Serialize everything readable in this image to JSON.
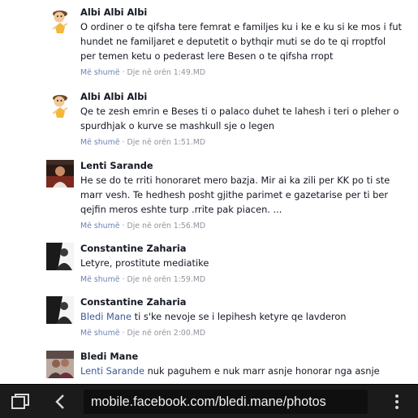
{
  "comments": [
    {
      "author": "Albi Albi Albi",
      "avatar_icon": "cartoon-character-avatar-icon",
      "lines": [
        "O ordiner o te qifsha tere femrat e familjes ku i ke e ku si ke mos i fut",
        "hundet ne familjaret e deputetit o bythqir muti se do te qi rroptfol",
        "per temen ketu o pederast lere Besen o te qifsha rropt"
      ],
      "like_label": "Më shumë",
      "time": "Dje në orën 1:49.MD"
    },
    {
      "author": "Albi Albi Albi",
      "avatar_icon": "cartoon-character-avatar-icon",
      "lines": [
        "Qe te zesh emrin e Beses ti o palaco duhet te lahesh i teri o pleher o",
        "spurdhjak o kurve se mashkull sje o legen"
      ],
      "like_label": "Më shumë",
      "time": "Dje në orën 1:51.MD"
    },
    {
      "author": "Lenti Sarande",
      "avatar_icon": "profile-photo-icon",
      "lines": [
        "He se do te rriti honoraret mero bazja. Mir ai ka zili per KK po ti ste",
        "marr vesh. Te hedhesh posht gjithe parimet e gazetarise per ti ber",
        "qejfin meros eshte turp .rrite pak piacen. ..."
      ],
      "like_label": "Më shumë",
      "time": "Dje në orën 1:56.MD"
    },
    {
      "author": "Constantine Zaharia",
      "avatar_icon": "profile-photo-icon",
      "lines": [
        "Letyre, prostitute mediatike"
      ],
      "like_label": "Më shumë",
      "time": "Dje në orën 1:59.MD"
    },
    {
      "author": "Constantine Zaharia",
      "avatar_icon": "profile-photo-icon",
      "mention": "Bledi Mane",
      "lines": [
        " ti s'ke nevoje se i lepihesh ketyre qe lavderon"
      ],
      "like_label": "Më shumë",
      "time": "Dje në orën 2:00.MD"
    },
    {
      "author": "Bledi Mane",
      "avatar_icon": "profile-photo-icon",
      "mention": "Lenti Sarande",
      "lines": [
        " nuk paguhem e nuk marr asnje honorar nga asnje"
      ],
      "like_label": "",
      "time": ""
    }
  ],
  "meta_separator": "·",
  "browser": {
    "url": "mobile.facebook.com/bledi.mane/photos",
    "tabs_icon": "tabs-icon",
    "back_icon": "back-chevron-icon",
    "menu_icon": "more-vertical-icon"
  },
  "colors": {
    "link": "#3b5998",
    "like": "#6d84b4",
    "meta": "#90949c",
    "toolbar": "#1b1b1b"
  }
}
